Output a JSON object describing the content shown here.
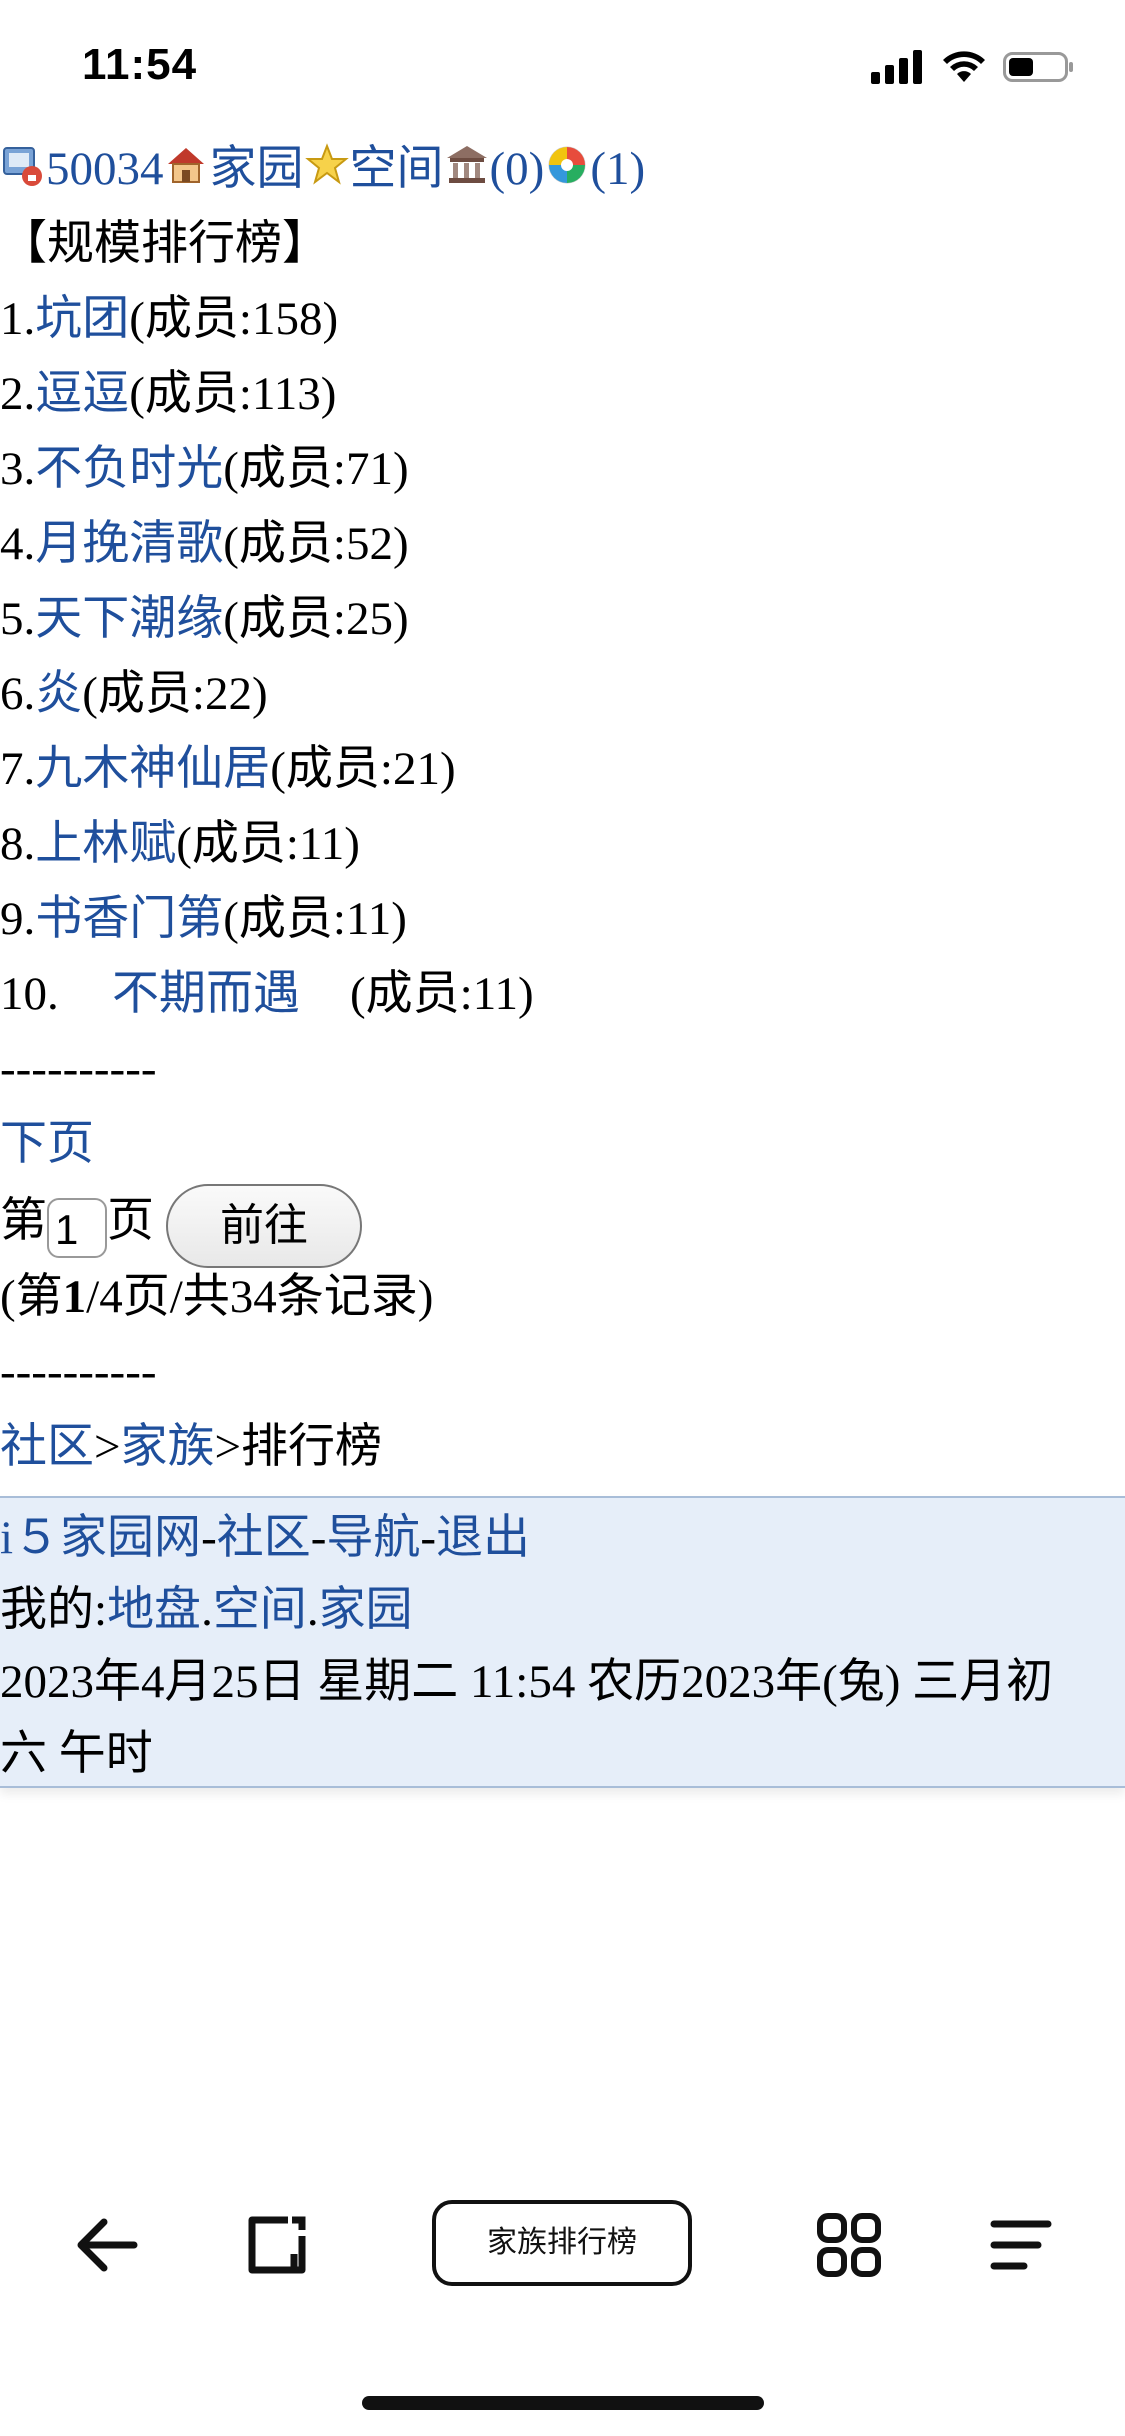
{
  "status_bar": {
    "time": "11:54"
  },
  "top_nav": {
    "user_id": "50034",
    "home": "家园",
    "space": "空间",
    "bank_count": "(0)",
    "extra_count": "(1)"
  },
  "page": {
    "title": "【规模排行榜】",
    "rows": [
      {
        "rank": "1.",
        "name": "坑团",
        "members": "(成员:158)"
      },
      {
        "rank": "2.",
        "name": "逗逗",
        "members": "(成员:113)"
      },
      {
        "rank": "3.",
        "name": "不负时光",
        "members": "(成员:71)"
      },
      {
        "rank": "4.",
        "name": "月挽清歌",
        "members": "(成员:52)"
      },
      {
        "rank": "5.",
        "name": "天下潮缘",
        "members": "(成员:25)"
      },
      {
        "rank": "6.",
        "name": "炎",
        "members": "(成员:22)"
      },
      {
        "rank": "7.",
        "name": "九木神仙居",
        "members": "(成员:21)"
      },
      {
        "rank": "8.",
        "name": "上林赋",
        "members": "(成员:11)"
      },
      {
        "rank": "9.",
        "name": "书香门第",
        "members": "(成员:11)"
      },
      {
        "rank": "10.",
        "name": "不期而遇",
        "members": "(成员:11)"
      }
    ],
    "divider": "----------",
    "next_page": "下页",
    "page_prefix": "第",
    "page_value": "1",
    "page_suffix": "页",
    "go_label": "前往",
    "record_open": "(第",
    "record_current": "1",
    "record_rest": "/4页/共34条记录)",
    "breadcrumb_community": "社区",
    "breadcrumb_sep1": ">",
    "breadcrumb_family": "家族",
    "breadcrumb_sep2": ">",
    "breadcrumb_current": "排行榜"
  },
  "footer": {
    "site": "i５家园网",
    "dash1": "-",
    "community": "社区",
    "dash2": "-",
    "nav": "导航",
    "dash3": "-",
    "logout": "退出",
    "mine_label": "我的:",
    "territory": "地盘",
    "dot1": ".",
    "space": "空间",
    "dot2": ".",
    "home": "家园",
    "date_line1": "2023年4月25日  星期二  11:54  农历2023年(兔)  三月初",
    "date_line2": "六  午时"
  },
  "browser": {
    "tab_title": "家族排行榜"
  }
}
